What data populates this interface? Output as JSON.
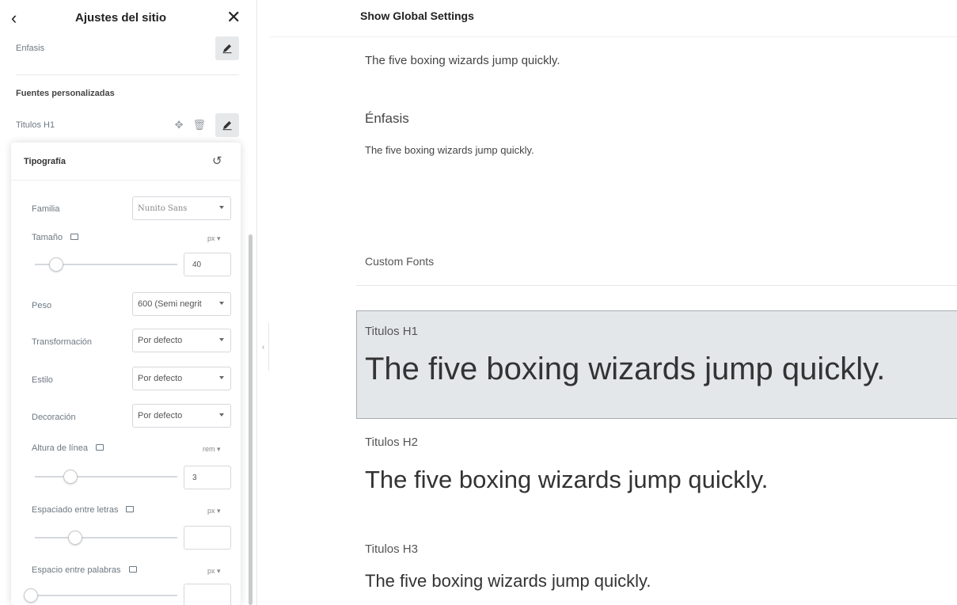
{
  "sidebar": {
    "title": "Ajustes del sitio",
    "emphasis_label": "Enfasis",
    "custom_fonts_title": "Fuentes personalizadas",
    "h1_label": "Titulos H1"
  },
  "typography": {
    "title": "Tipografía",
    "family_label": "Familia",
    "family_value": "Nunito Sans",
    "size_label": "Tamaño",
    "size_unit": "px",
    "size_value": "40",
    "weight_label": "Peso",
    "weight_value": "600 (Semi negrit",
    "transform_label": "Transformación",
    "transform_value": "Por defecto",
    "style_label": "Estilo",
    "style_value": "Por defecto",
    "decoration_label": "Decoración",
    "decoration_value": "Por defecto",
    "line_height_label": "Altura de línea",
    "line_height_unit": "rem",
    "line_height_value": "3",
    "letter_spacing_label": "Espaciado entre letras",
    "letter_spacing_unit": "px",
    "letter_spacing_value": "",
    "word_spacing_label": "Espacio entre palabras",
    "word_spacing_unit": "px",
    "word_spacing_value": ""
  },
  "preview": {
    "title": "Show Global Settings",
    "sample_1": "The five boxing wizards jump quickly.",
    "emphasis_heading": "Énfasis",
    "emphasis_sample": "The five boxing wizards jump quickly.",
    "custom_fonts_heading": "Custom Fonts",
    "h1_label": "Titulos H1",
    "h1_sample": "The five boxing wizards jump quickly.",
    "h2_label": "Titulos H2",
    "h2_sample": "The five boxing wizards jump quickly.",
    "h3_label": "Titulos H3",
    "h3_sample": "The five boxing wizards jump quickly."
  },
  "icons": {
    "back": "chevron-left-icon",
    "close": "close-icon",
    "edit": "pencil-icon",
    "move": "move-icon",
    "delete": "trash-icon",
    "reset": "reset-icon",
    "responsive": "monitor-icon"
  }
}
